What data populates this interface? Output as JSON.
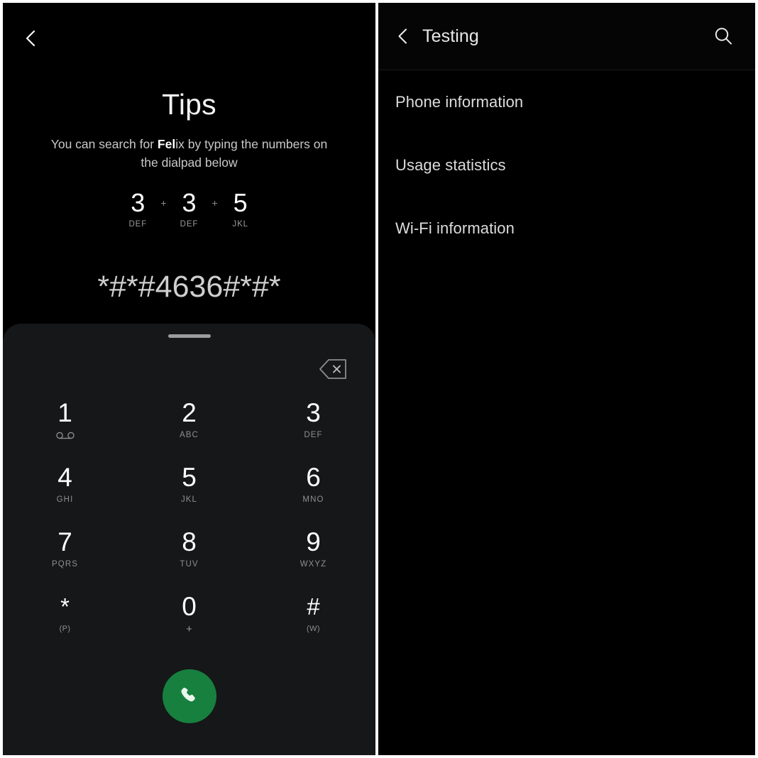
{
  "colors": {
    "background": "#000000",
    "sheet": "#161719",
    "call_green": "#17803f",
    "primary_text": "#ffffff",
    "secondary_text": "#8f8f8f",
    "divider": "#1b1b1b"
  },
  "dialer": {
    "back_icon": "back-chevron-icon",
    "tips": {
      "title": "Tips",
      "subtitle_prefix": "You can search for ",
      "subtitle_bold": "Fel",
      "subtitle_suffix": "ix by typing the numbers on the dialpad below"
    },
    "hint": {
      "separator": "+",
      "keys": [
        {
          "digit": "3",
          "letters": "DEF"
        },
        {
          "digit": "3",
          "letters": "DEF"
        },
        {
          "digit": "5",
          "letters": "JKL"
        }
      ]
    },
    "dialed_code": "*#*#4636#*#*",
    "sheet": {
      "handle_name": "drag-handle",
      "backspace_icon": "backspace-icon"
    },
    "keypad": [
      [
        {
          "digit": "1",
          "sub": "",
          "sub_icon": "voicemail-icon"
        },
        {
          "digit": "2",
          "sub": "ABC",
          "sub_icon": ""
        },
        {
          "digit": "3",
          "sub": "DEF",
          "sub_icon": ""
        }
      ],
      [
        {
          "digit": "4",
          "sub": "GHI",
          "sub_icon": ""
        },
        {
          "digit": "5",
          "sub": "JKL",
          "sub_icon": ""
        },
        {
          "digit": "6",
          "sub": "MNO",
          "sub_icon": ""
        }
      ],
      [
        {
          "digit": "7",
          "sub": "PQRS",
          "sub_icon": ""
        },
        {
          "digit": "8",
          "sub": "TUV",
          "sub_icon": ""
        },
        {
          "digit": "9",
          "sub": "WXYZ",
          "sub_icon": ""
        }
      ],
      [
        {
          "digit": "*",
          "sub": "(P)",
          "sub_icon": ""
        },
        {
          "digit": "0",
          "sub": "+",
          "sub_icon": ""
        },
        {
          "digit": "#",
          "sub": "(W)",
          "sub_icon": ""
        }
      ]
    ],
    "call_button": {
      "icon": "phone-call-icon",
      "label": "Call"
    }
  },
  "testing": {
    "appbar": {
      "back_icon": "back-chevron-icon",
      "title": "Testing",
      "search_icon": "search-icon"
    },
    "items": [
      {
        "label": "Phone information"
      },
      {
        "label": "Usage statistics"
      },
      {
        "label": "Wi-Fi information"
      }
    ]
  }
}
